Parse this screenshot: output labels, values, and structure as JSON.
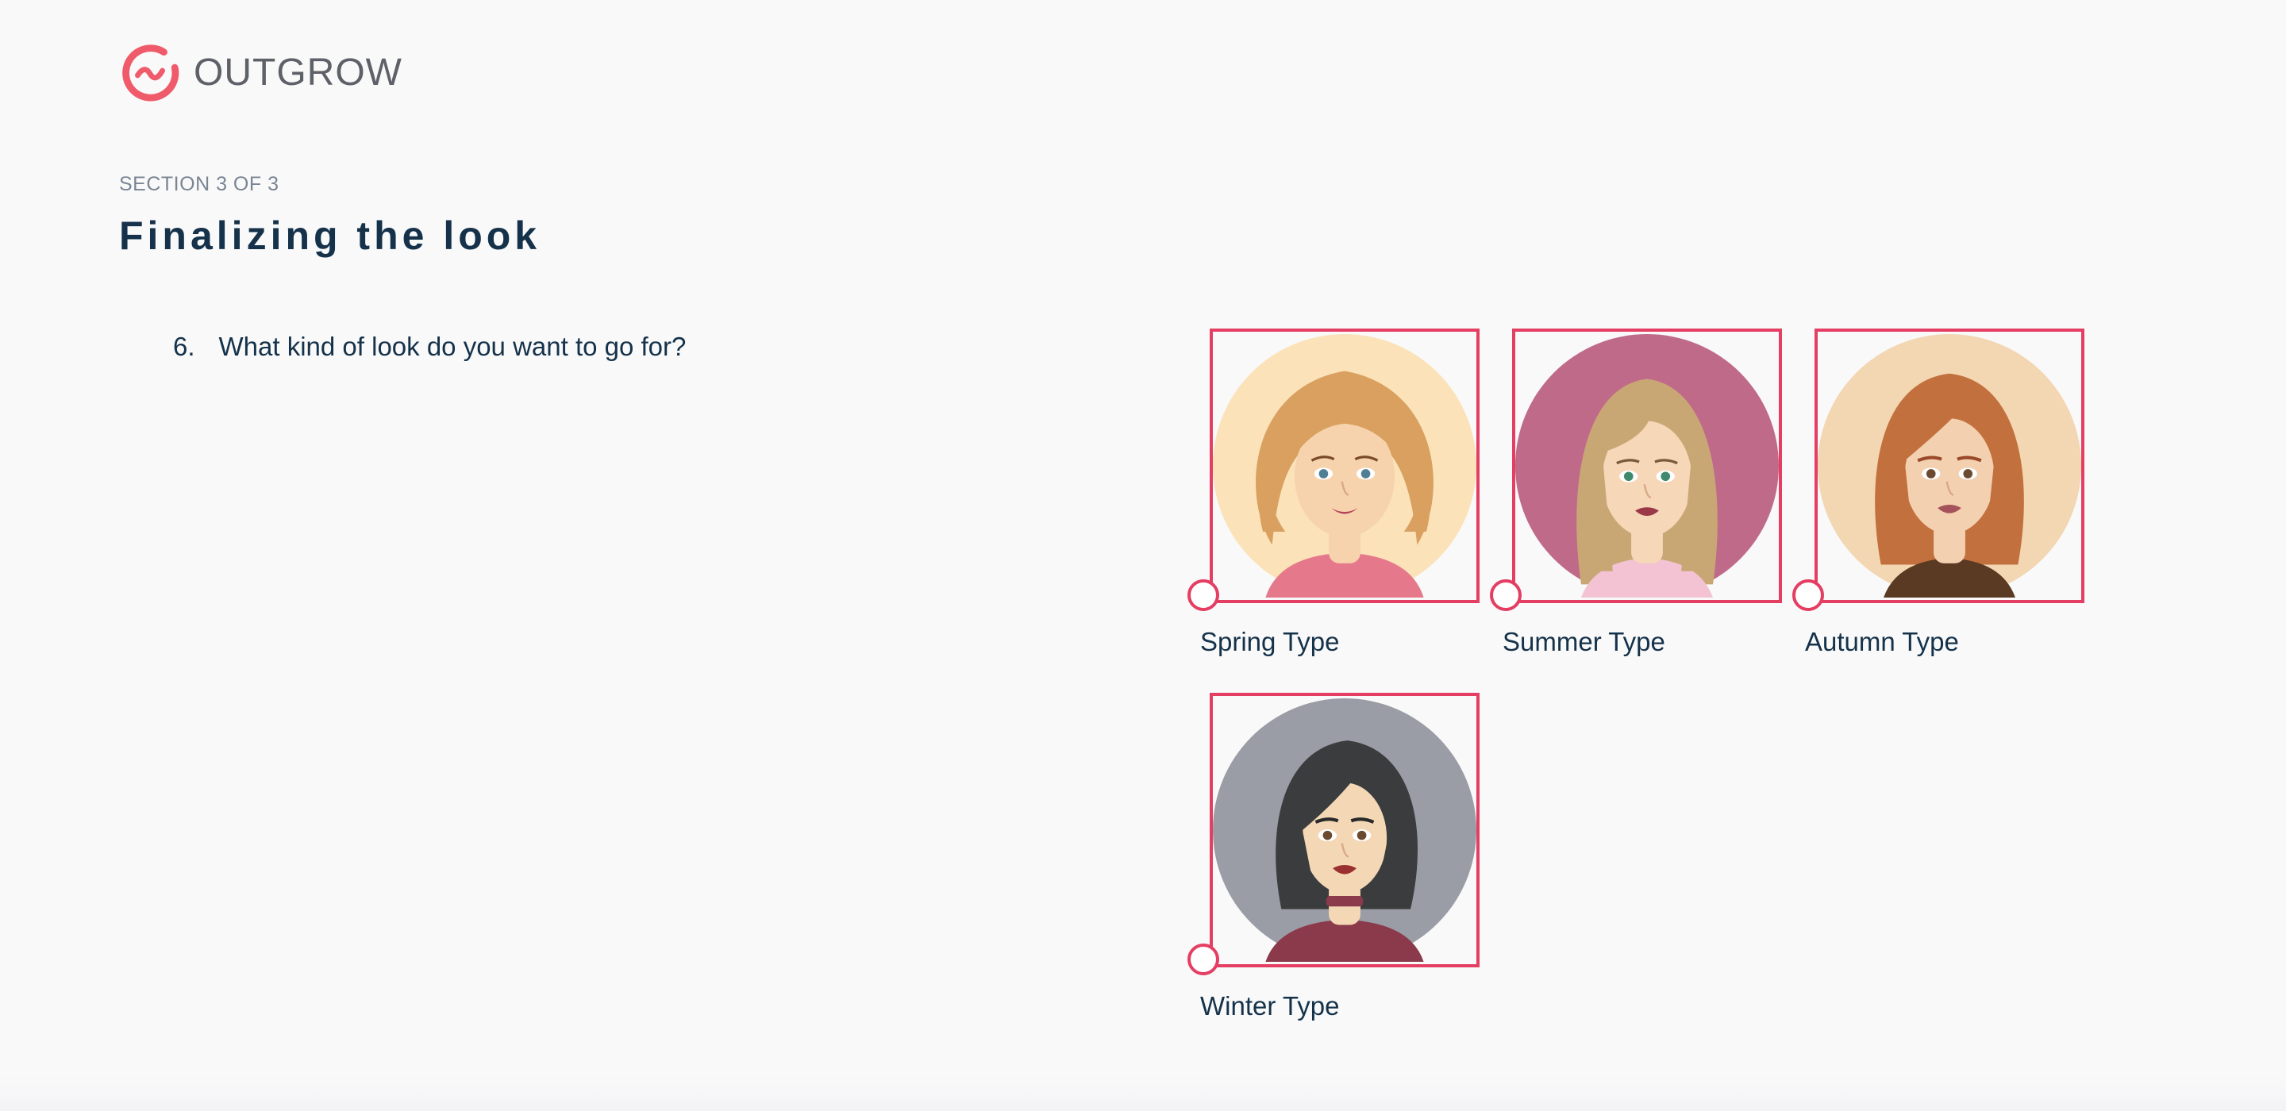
{
  "brand": {
    "name": "OUTGROW",
    "accent": "#ef5b6a"
  },
  "section": {
    "label": "SECTION 3 OF 3",
    "title": "Finalizing the look"
  },
  "question": {
    "number": "6.",
    "text": "What kind of look do you want to go for?"
  },
  "options": [
    {
      "label": "Spring Type",
      "selected": false,
      "bg": "#fbe2b8",
      "hair": "#d9a060",
      "skin": "#f6d3ac",
      "eye": "#4f7f95",
      "lips": "#b4405a",
      "top": "#e6788c"
    },
    {
      "label": "Summer Type",
      "selected": false,
      "bg": "#c06a8a",
      "hair": "#c9a775",
      "skin": "#f6d7b8",
      "eye": "#3f8a6e",
      "lips": "#9b3848",
      "top": "#f3c3d3"
    },
    {
      "label": "Autumn Type",
      "selected": false,
      "bg": "#f3d6b2",
      "hair": "#c2703d",
      "skin": "#f3d0b0",
      "eye": "#6b4a30",
      "lips": "#a6525a",
      "top": "#5a3a22"
    },
    {
      "label": "Winter Type",
      "selected": false,
      "bg": "#9a9ca6",
      "hair": "#3b3c3e",
      "skin": "#f4d8b6",
      "eye": "#6b4a30",
      "lips": "#9b3030",
      "top": "#8a3a4a"
    }
  ],
  "colors": {
    "option_border": "#e43e63",
    "text": "#15324a"
  }
}
